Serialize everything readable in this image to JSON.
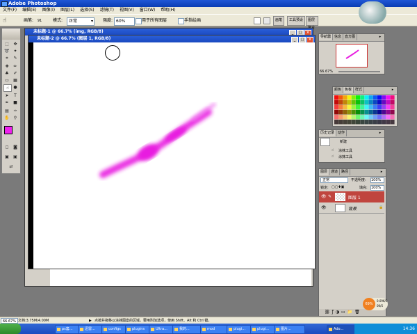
{
  "app": {
    "title": "Adobe Photoshop"
  },
  "menu": {
    "items": [
      "文件(F)",
      "编辑(E)",
      "图像(I)",
      "图层(L)",
      "选择(S)",
      "滤镜(T)",
      "视图(V)",
      "窗口(W)",
      "帮助(H)"
    ]
  },
  "options": {
    "brush_label": "画笔:",
    "brush_size": "91",
    "mode_label": "模式:",
    "mode_value": "正常",
    "strength_label": "强度:",
    "strength_value": "60%",
    "all_layers_label": "用于所有图层",
    "finger_label": "手指绘画",
    "well_tabs": [
      "画笔",
      "工具预设",
      "图层复合"
    ]
  },
  "doc1": {
    "title": "未标题-1 @ 66.7% (img, RGB/8)"
  },
  "doc2": {
    "title": "未标题-2 @ 66.7% (图层 1, RGB/8)"
  },
  "navigator": {
    "tabs": [
      "导航器",
      "信息",
      "直方图"
    ],
    "zoom": "66.67%"
  },
  "swatches": {
    "tabs": [
      "颜色",
      "色板",
      "样式"
    ]
  },
  "history": {
    "tabs": [
      "历史记录",
      "动作"
    ],
    "items": [
      "新建",
      "涂抹工具",
      "涂抹工具"
    ]
  },
  "layers": {
    "tabs": [
      "图层",
      "通道",
      "路径"
    ],
    "blend_mode": "正常",
    "opacity_label": "不透明度:",
    "opacity_value": "100%",
    "lock_label": "锁定:",
    "fill_label": "填充:",
    "fill_value": "100%",
    "rows": [
      {
        "name": "图层 1",
        "selected": true
      },
      {
        "name": "背景",
        "selected": false
      }
    ]
  },
  "status": {
    "zoom": "66.67%",
    "doc_info": "文档:3.75M/4.00M",
    "hint": "点按并拖移以涂抹图案的区域。要用附加选项，使用 Shift、Alt 和 Ctrl 键。"
  },
  "badge": {
    "percent": "69%",
    "up": "0.09K/S",
    "down": "0K/S"
  },
  "taskbar": {
    "buttons": [
      "ps套...",
      "迅雷...",
      "configs",
      "plugins",
      "Ultra...",
      "我的...",
      "mod",
      "plugi...",
      "plugi...",
      "图片...",
      "Ado..."
    ],
    "clock": "14:36"
  },
  "colors": {
    "brush_stroke": "#e81fe0",
    "foreground": "#ee22ee",
    "background": "#000000"
  }
}
